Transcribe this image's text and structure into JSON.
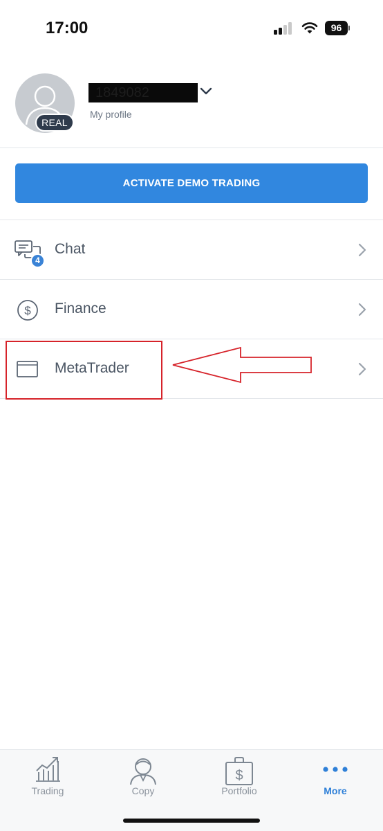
{
  "status_bar": {
    "time": "17:00",
    "battery_level": "96",
    "signal_bars_active": 2,
    "signal_bars_total": 4
  },
  "profile": {
    "account_id": "1849082",
    "account_type_badge": "REAL",
    "subtitle": "My profile",
    "avatar_icon": "user-silhouette-icon",
    "expand_icon": "chevron-down-icon"
  },
  "demo_button": {
    "label": "ACTIVATE DEMO TRADING",
    "color": "#3187df"
  },
  "menu": {
    "items": [
      {
        "label": "Chat",
        "icon": "chat-bubbles-icon",
        "badge": "4"
      },
      {
        "label": "Finance",
        "icon": "dollar-circle-icon"
      },
      {
        "label": "MetaTrader",
        "icon": "window-icon"
      }
    ]
  },
  "annotation": {
    "color": "#d6232a",
    "target": "MetaTrader"
  },
  "tab_bar": {
    "tabs": [
      {
        "label": "Trading",
        "icon": "trading-chart-icon",
        "active": false
      },
      {
        "label": "Copy",
        "icon": "copy-trader-icon",
        "active": false
      },
      {
        "label": "Portfolio",
        "icon": "portfolio-briefcase-icon",
        "active": false
      },
      {
        "label": "More",
        "icon": "more-dots-icon",
        "active": true
      }
    ],
    "active_color": "#2f80d8"
  }
}
